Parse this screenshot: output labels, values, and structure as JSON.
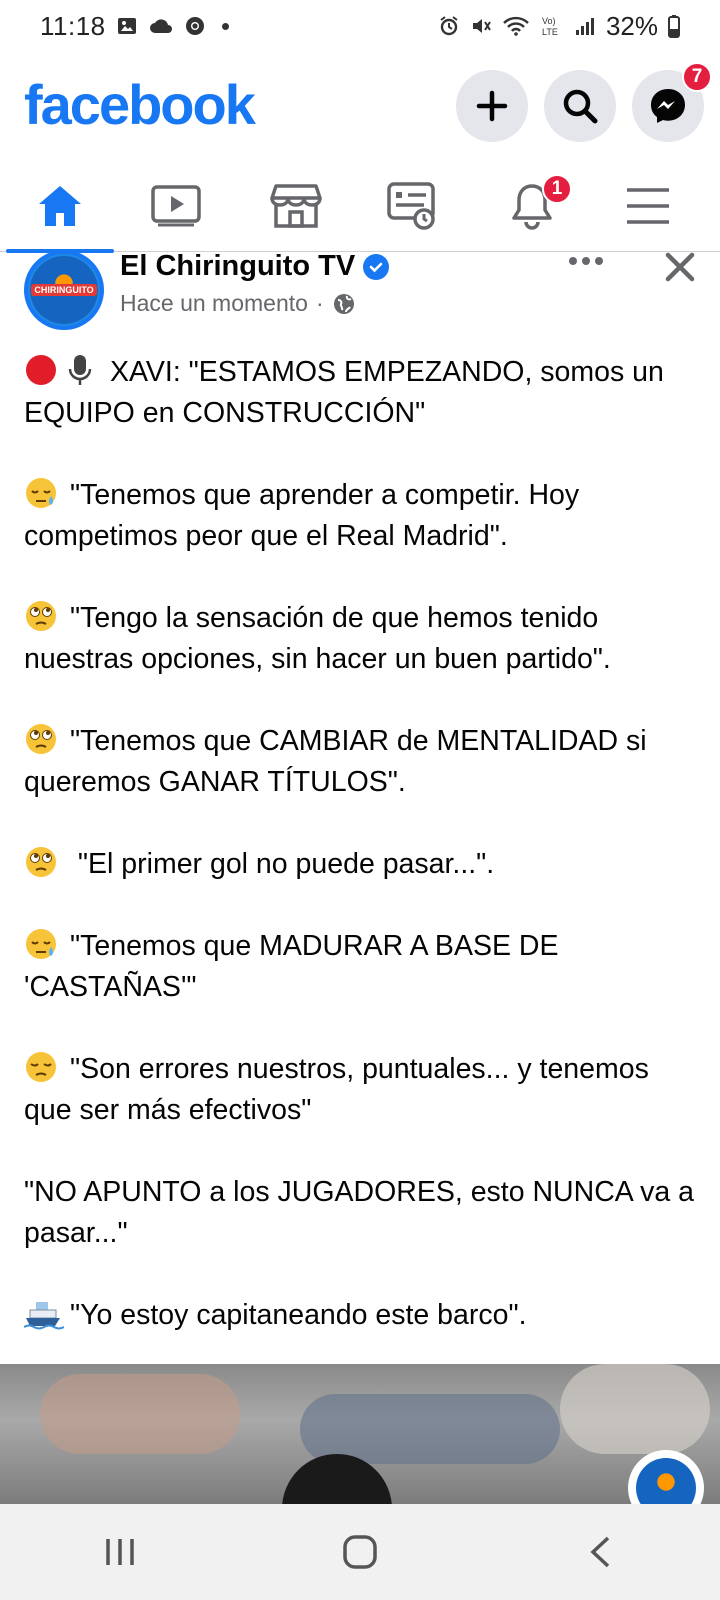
{
  "status_bar": {
    "time": "11:18",
    "battery": "32%",
    "icons_left": [
      "gallery-icon",
      "cloud-icon",
      "chrome-icon",
      "dot-icon"
    ],
    "icons_right": [
      "alarm-icon",
      "mute-icon",
      "wifi-icon",
      "volte-icon",
      "signal-icon",
      "battery-icon"
    ]
  },
  "header": {
    "logo": "facebook",
    "brand_color": "#1877f2",
    "messenger_badge": "7"
  },
  "tabs": [
    {
      "name": "home",
      "active": true
    },
    {
      "name": "watch",
      "active": false
    },
    {
      "name": "marketplace",
      "active": false
    },
    {
      "name": "news",
      "active": false
    },
    {
      "name": "notifications",
      "active": false,
      "badge": "1"
    },
    {
      "name": "menu",
      "active": false
    }
  ],
  "post": {
    "page_name": "El Chiringuito TV",
    "time": "Hace un momento",
    "separator": "·",
    "avatar_text": "CHIRINGUITO",
    "paragraphs": [
      {
        "emoji": "red-circle-microphone",
        "text": "XAVI: \"ESTAMOS EMPEZANDO, somos un EQUIPO en CONSTRUCCIÓN\""
      },
      {
        "emoji": "sleepy-face",
        "text": "\"Tenemos que aprender a competir. Hoy competimos peor que el Real Madrid\"."
      },
      {
        "emoji": "rolling-eyes",
        "text": "\"Tengo la sensación de que hemos tenido nuestras opciones, sin hacer un buen partido\"."
      },
      {
        "emoji": "rolling-eyes",
        "text": "\"Tenemos que CAMBIAR de MENTALIDAD si queremos GANAR TÍTULOS\"."
      },
      {
        "emoji": "rolling-eyes",
        "text": " \"El primer gol no puede pasar...\"."
      },
      {
        "emoji": "sleepy-face",
        "text": "\"Tenemos que MADURAR A BASE DE 'CASTAÑAS'\""
      },
      {
        "emoji": "pensive-face",
        "text": "\"Son errores nuestros, puntuales... y tenemos que ser más efectivos\""
      },
      {
        "emoji": "",
        "text": "\"NO APUNTO a los JUGADORES, esto NUNCA va a pasar...\""
      },
      {
        "emoji": "ship",
        "text": "\"Yo estoy capitaneando este barco\"."
      }
    ]
  },
  "navbar": [
    "recents-icon",
    "home-circle-icon",
    "back-icon"
  ]
}
